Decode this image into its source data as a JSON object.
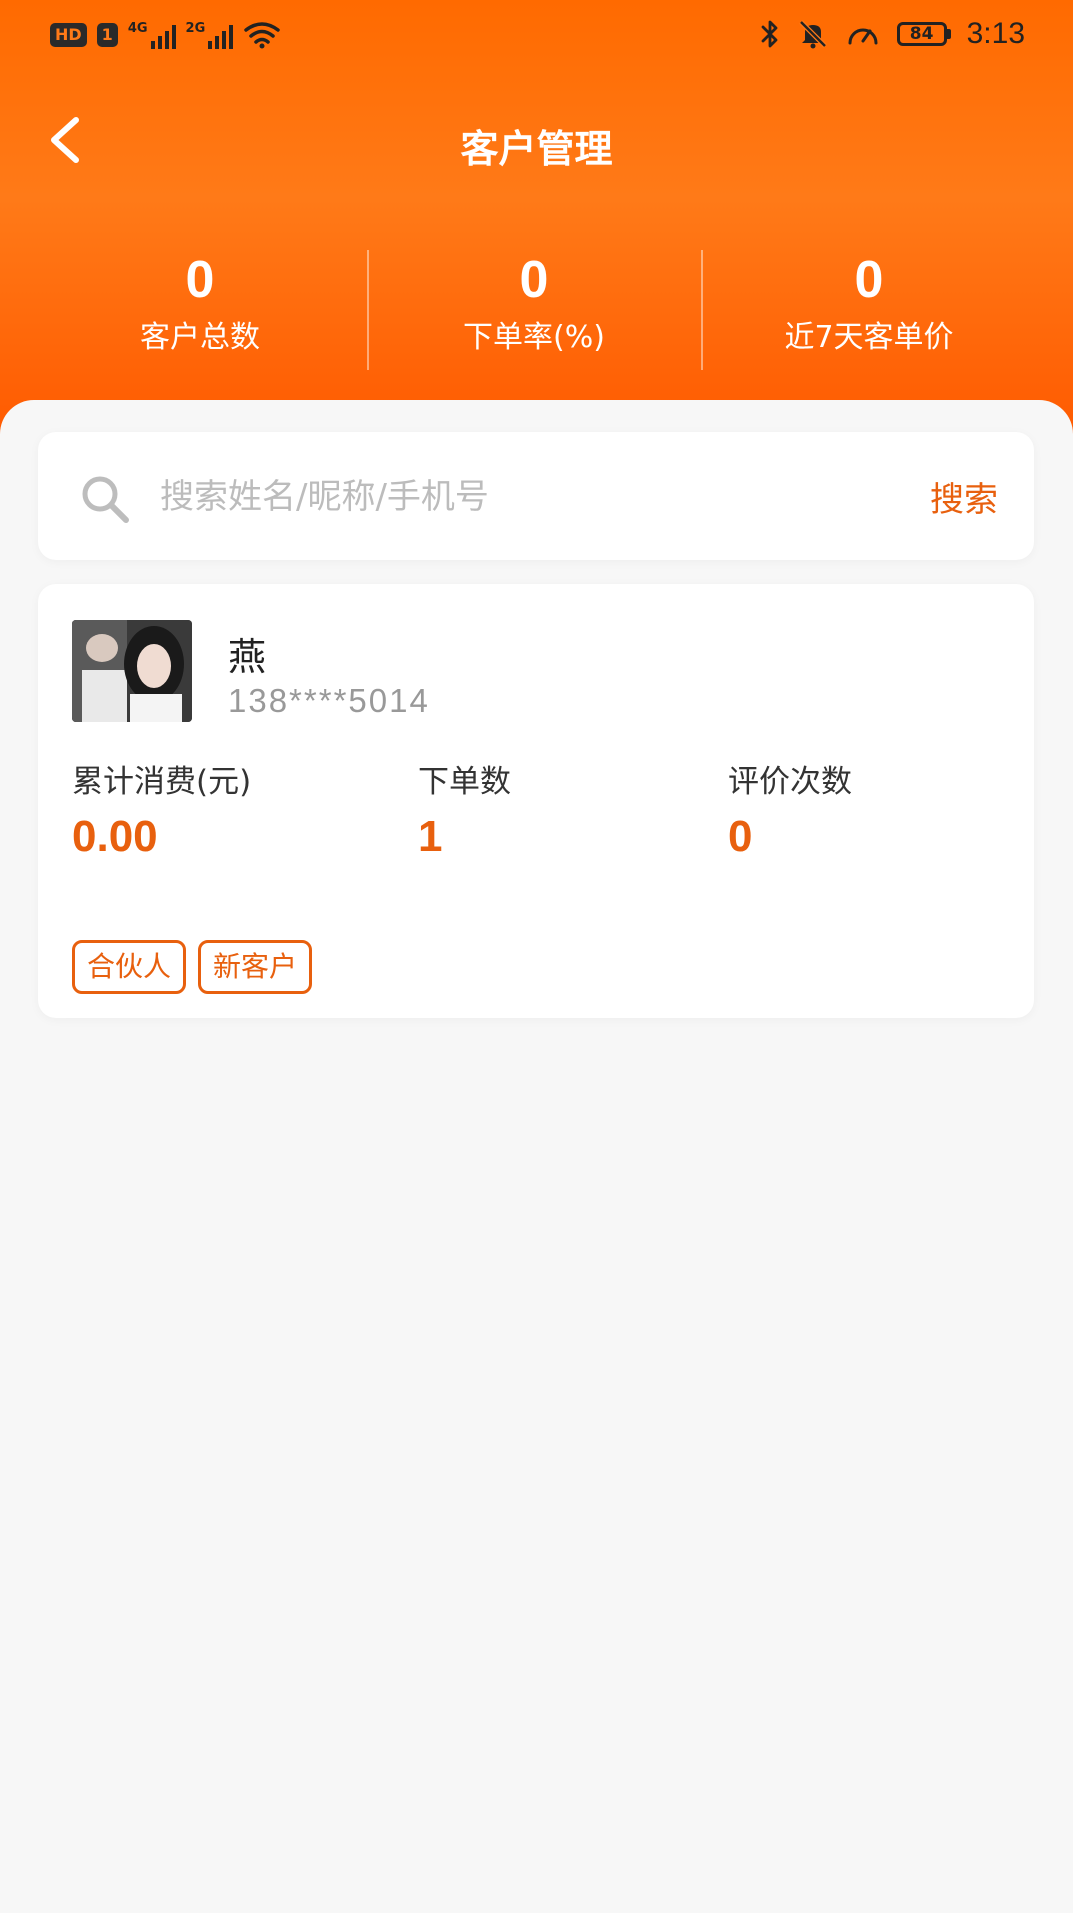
{
  "status_bar": {
    "hd_label": "HD",
    "sim_label": "1",
    "signal_1_tag": "4G",
    "signal_2_tag": "2G",
    "battery_level": "84",
    "time": "3:13",
    "icons": [
      "bluetooth-icon",
      "mute-bell-icon",
      "speed-meter-icon",
      "battery-icon"
    ]
  },
  "nav": {
    "title": "客户管理"
  },
  "stats": [
    {
      "value": "0",
      "label": "客户总数"
    },
    {
      "value": "0",
      "label": "下单率(%)"
    },
    {
      "value": "0",
      "label": "近7天客单价"
    }
  ],
  "search": {
    "placeholder": "搜索姓名/昵称/手机号",
    "button_label": "搜索"
  },
  "customer": {
    "name": "燕",
    "phone": "138****5014",
    "metrics": [
      {
        "label": "累计消费(元)",
        "value": "0.00"
      },
      {
        "label": "下单数",
        "value": "1"
      },
      {
        "label": "评价次数",
        "value": "0"
      }
    ],
    "tags": [
      "合伙人",
      "新客户"
    ]
  },
  "colors": {
    "brand": "#ff6a00",
    "accent": "#e8600e",
    "background": "#f7f7f7"
  }
}
